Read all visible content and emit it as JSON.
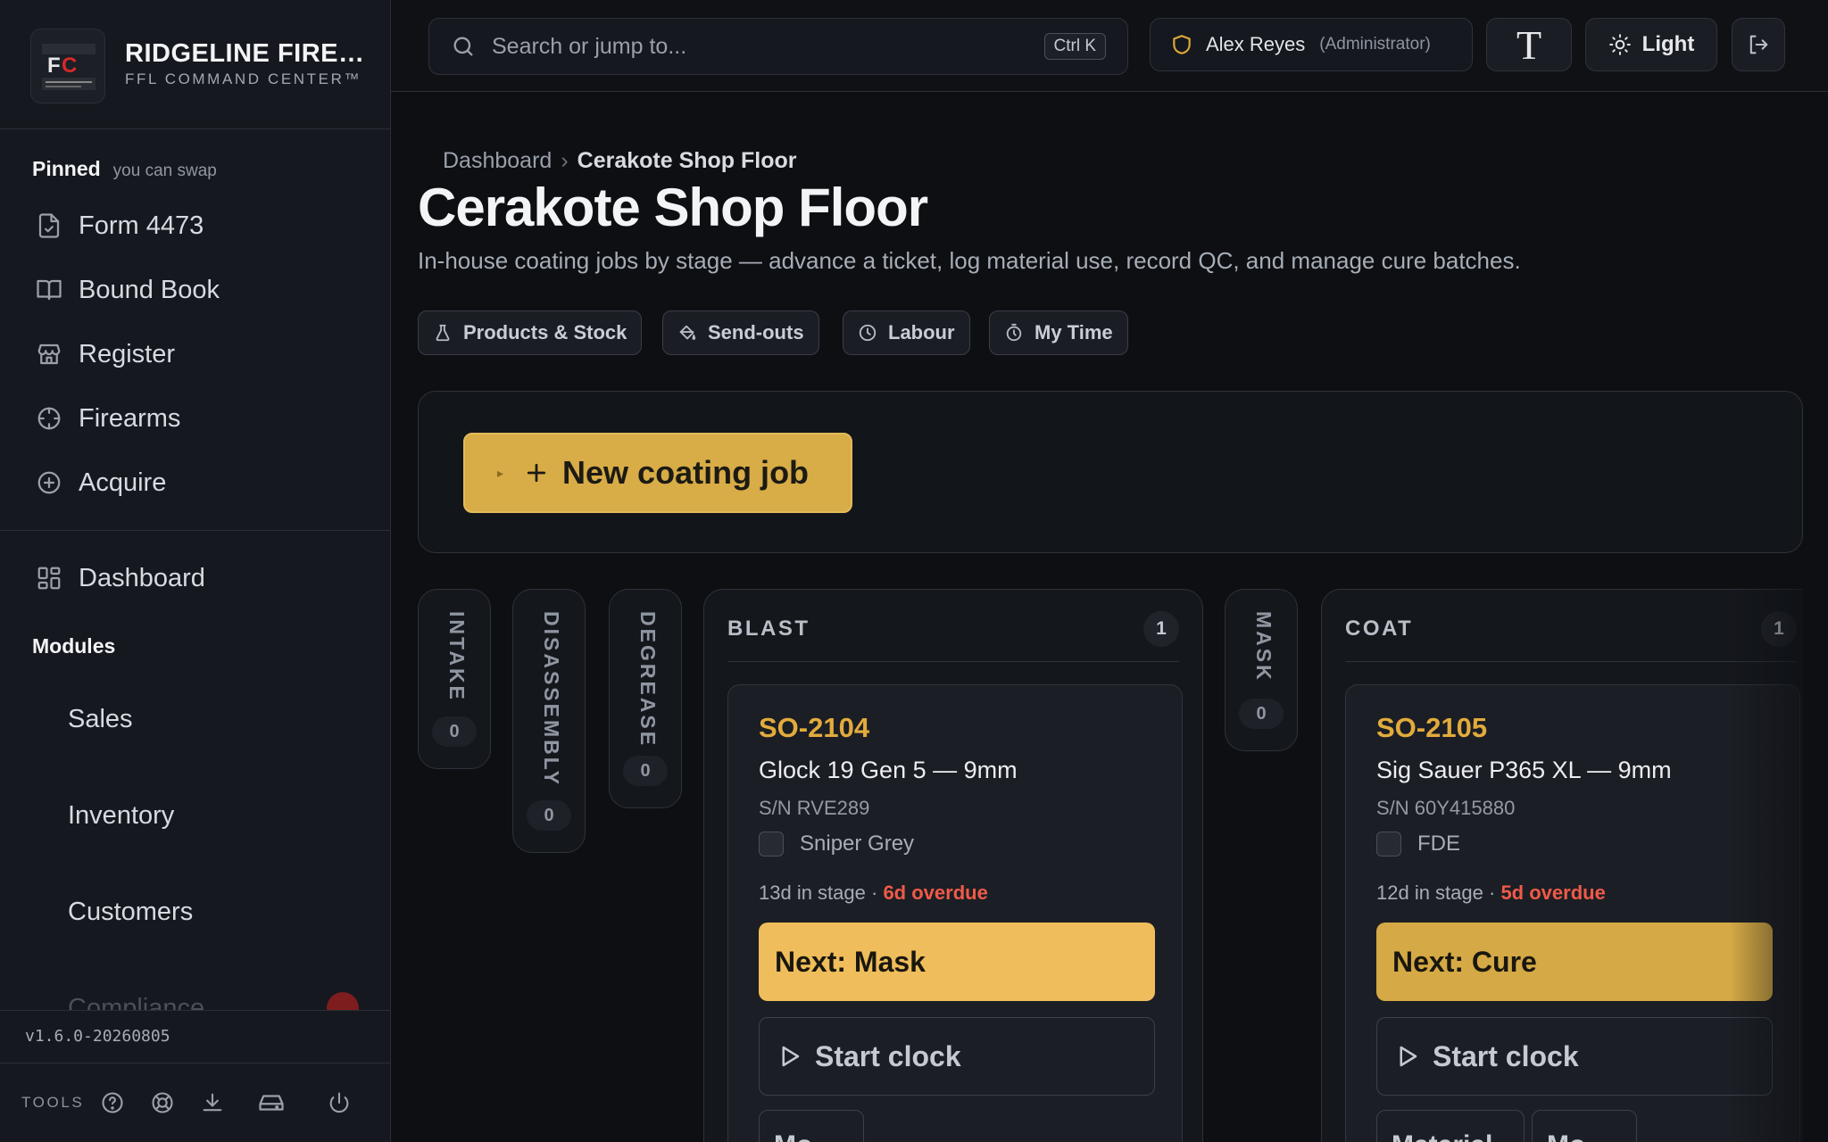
{
  "brand": {
    "name": "RIDGELINE FIRE…",
    "subtitle": "FFL COMMAND CENTER™",
    "logo_text": "FFL COMMAND CENTER"
  },
  "sidebar": {
    "pinned_title": "Pinned",
    "pinned_hint": "you can swap",
    "pinned": [
      {
        "label": "Form 4473",
        "icon": "form-icon"
      },
      {
        "label": "Bound Book",
        "icon": "book-icon"
      },
      {
        "label": "Register",
        "icon": "store-icon"
      },
      {
        "label": "Firearms",
        "icon": "crosshair-icon"
      },
      {
        "label": "Acquire",
        "icon": "plus-circle-icon"
      }
    ],
    "dashboard": "Dashboard",
    "modules_title": "Modules",
    "modules": [
      "Sales",
      "Inventory",
      "Customers",
      "Compliance"
    ],
    "version": "v1.6.0-20260805",
    "tools_label": "TOOLS"
  },
  "topbar": {
    "search_placeholder": "Search or jump to...",
    "search_shortcut": "Ctrl K",
    "user_name": "Alex Reyes",
    "user_role": "(Administrator)",
    "text_size_glyph": "T",
    "theme_label": "Light"
  },
  "page": {
    "breadcrumb_root": "Dashboard",
    "breadcrumb_sep": "›",
    "breadcrumb_current": "Cerakote Shop Floor",
    "title": "Cerakote Shop Floor",
    "subtitle": "In-house coating jobs by stage — advance a ticket, log material use, record QC, and manage cure batches.",
    "chips": [
      {
        "label": "Products & Stock",
        "icon": "flask-icon"
      },
      {
        "label": "Send-outs",
        "icon": "paint-bucket-icon"
      },
      {
        "label": "Labour",
        "icon": "clock-icon"
      },
      {
        "label": "My Time",
        "icon": "stopwatch-icon"
      }
    ],
    "new_job_label": "New coating job",
    "new_job_caret": "▸"
  },
  "board": {
    "collapsed": [
      {
        "name": "INTAKE",
        "count": "0"
      },
      {
        "name": "DISASSEMBLY",
        "count": "0"
      },
      {
        "name": "DEGREASE",
        "count": "0"
      },
      {
        "name": "MASK",
        "count": "0"
      }
    ],
    "blast": {
      "name": "BLAST",
      "count": "1",
      "card": {
        "id": "SO-2104",
        "model": "Glock 19 Gen 5 — 9mm",
        "serial": "S/N RVE289",
        "finish": "Sniper Grey",
        "days": "13d in stage ·",
        "overdue": "6d overdue",
        "next": "Next: Mask",
        "start": "Start clock",
        "mini": [
          "Mo…"
        ]
      }
    },
    "coat": {
      "name": "COAT",
      "count": "1",
      "card": {
        "id": "SO-2105",
        "model": "Sig Sauer P365 XL — 9mm",
        "serial": "S/N 60Y415880",
        "finish": "FDE",
        "days": "12d in stage ·",
        "overdue": "5d overdue",
        "next": "Next: Cure",
        "start": "Start clock",
        "mini": [
          "Material",
          "Mo…"
        ]
      }
    }
  },
  "colors": {
    "accent": "#d8ac46",
    "next_button": "#efbd5b",
    "so_id": "#e2ab3c",
    "overdue": "#ef5a48",
    "background": "#0d0f13",
    "sidebar": "#15181e"
  }
}
